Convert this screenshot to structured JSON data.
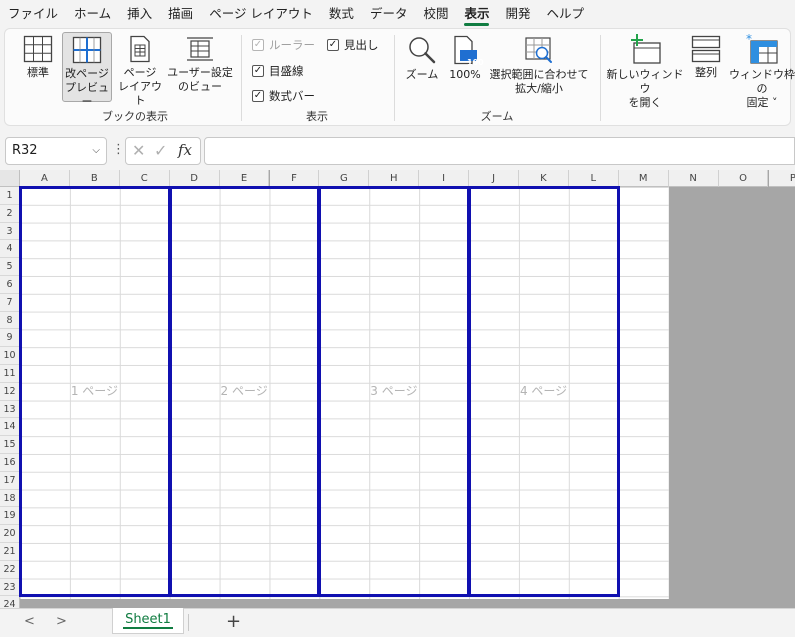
{
  "menu": {
    "tabs": [
      "ファイル",
      "ホーム",
      "挿入",
      "描画",
      "ページ レイアウト",
      "数式",
      "データ",
      "校閲",
      "表示",
      "開発",
      "ヘルプ"
    ],
    "active_tab": "表示"
  },
  "ribbon": {
    "book_view": {
      "group_label": "ブックの表示",
      "normal": "標準",
      "page_break_line1": "改ページ",
      "page_break_line2": "プレビュー",
      "page_layout_line1": "ページ",
      "page_layout_line2": "レイアウト",
      "custom_line1": "ユーザー設定",
      "custom_line2": "のビュー"
    },
    "show": {
      "group_label": "表示",
      "ruler": "ルーラー",
      "gridlines": "目盛線",
      "formula_bar": "数式バー",
      "headings": "見出し"
    },
    "zoom": {
      "group_label": "ズーム",
      "zoom": "ズーム",
      "hundred": "100%",
      "hundred_icon": "100",
      "selection_line1": "選択範囲に合わせて",
      "selection_line2": "拡大/縮小"
    },
    "window": {
      "new_window_line1": "新しいウィンドウ",
      "new_window_line2": "を開く",
      "arrange": "整列",
      "freeze_line1": "ウィンドウ枠の",
      "freeze_line2": "固定 ˅"
    },
    "check_mark": "✓"
  },
  "formula_bar": {
    "name_box": "R32",
    "dropdown": "⌵",
    "more": "⋮",
    "cancel": "✕",
    "enter": "✓",
    "fx": "fx",
    "formula": ""
  },
  "grid": {
    "columns": [
      "A",
      "B",
      "C",
      "D",
      "E",
      "F",
      "G",
      "H",
      "I",
      "J",
      "K",
      "L",
      "M",
      "N",
      "O",
      "P"
    ],
    "rows": [
      "1",
      "2",
      "3",
      "4",
      "5",
      "6",
      "7",
      "8",
      "9",
      "10",
      "11",
      "12",
      "13",
      "14",
      "15",
      "16",
      "17",
      "18",
      "19",
      "20",
      "21",
      "22",
      "23",
      "24"
    ],
    "pages": [
      "1 ページ",
      "2 ページ",
      "3 ページ",
      "4 ページ"
    ]
  },
  "sheet_tabs": {
    "prev": "<",
    "next": ">",
    "sheets": [
      "Sheet1"
    ],
    "add": "+"
  }
}
